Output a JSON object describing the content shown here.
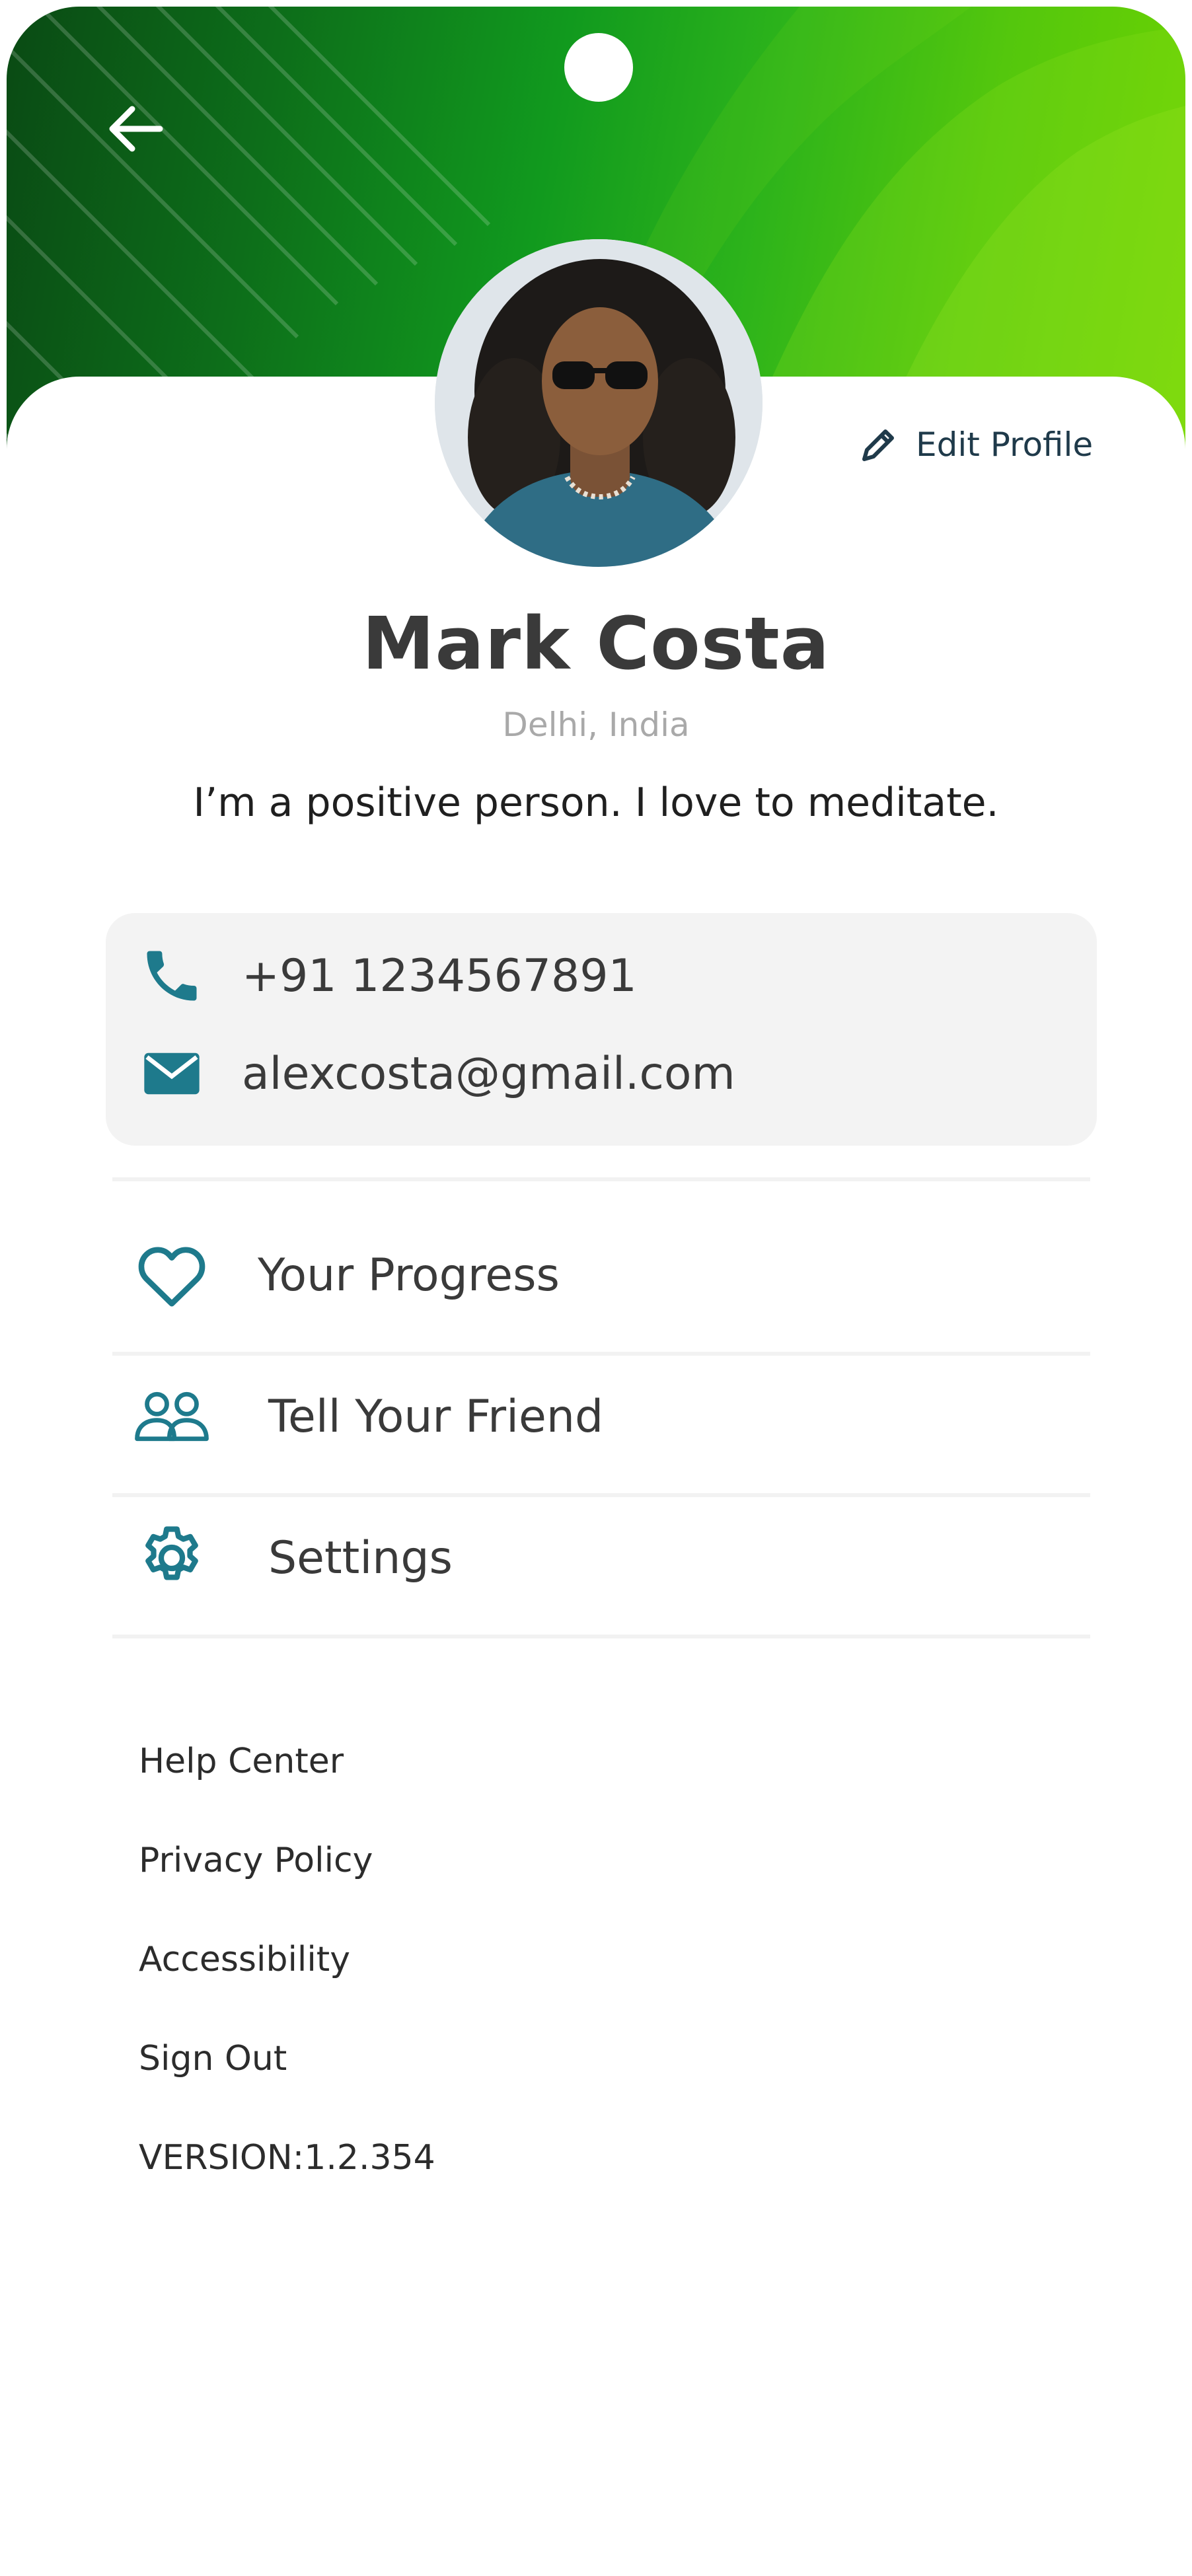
{
  "colors": {
    "header_gradient": [
      "#0a4a14",
      "#119a1e",
      "#6fd400"
    ],
    "icon_teal": "#1e7a8c",
    "contact_box_bg": "#f3f3f3",
    "edit_icon": "#1f3a4a"
  },
  "header": {
    "back_icon": "arrow-left-icon",
    "edit_icon": "pencil-icon",
    "edit_label": "Edit Profile"
  },
  "profile": {
    "name": "Mark Costa",
    "location": "Delhi, India",
    "bio": "I’m a positive person. I love to meditate."
  },
  "contact": {
    "phone_icon": "phone-icon",
    "phone": "+91 1234567891",
    "email_icon": "mail-icon",
    "email": "alexcosta@gmail.com"
  },
  "menu": [
    {
      "icon": "heart-icon",
      "label": "Your Progress"
    },
    {
      "icon": "users-icon",
      "label": "Tell Your Friend"
    },
    {
      "icon": "gear-icon",
      "label": "Settings"
    }
  ],
  "links": {
    "help": "Help Center",
    "privacy": "Privacy Policy",
    "accessibility": "Accessibility",
    "signout": "Sign Out"
  },
  "version": "VERSION:1.2.354"
}
